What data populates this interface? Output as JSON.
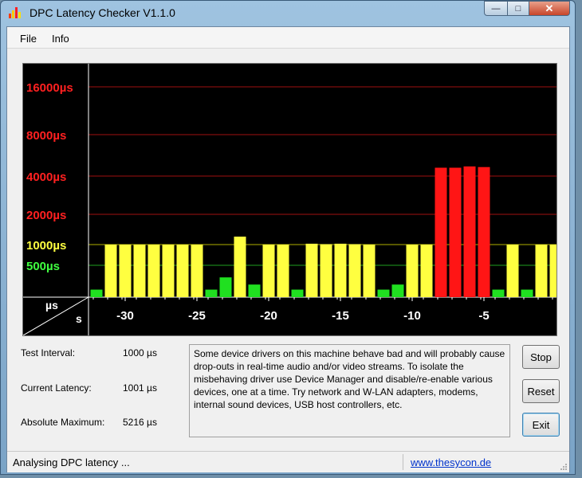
{
  "window": {
    "title": "DPC Latency Checker V1.1.0",
    "close_glyph": "✕",
    "min_glyph": "—",
    "max_glyph": "□"
  },
  "menu": [
    {
      "label": "File"
    },
    {
      "label": "Info"
    }
  ],
  "chart_data": {
    "type": "bar",
    "y_axis_labels": [
      {
        "label": "16000µs",
        "value": 16000,
        "color": "#ff2020"
      },
      {
        "label": "8000µs",
        "value": 8000,
        "color": "#ff2020"
      },
      {
        "label": "4000µs",
        "value": 4000,
        "color": "#ff2020"
      },
      {
        "label": "2000µs",
        "value": 2000,
        "color": "#ff2020"
      },
      {
        "label": "1000µs",
        "value": 1000,
        "color": "#ffff40"
      },
      {
        "label": "500µs",
        "value": 500,
        "color": "#40ff40"
      }
    ],
    "x_ticks": [
      "-30",
      "-25",
      "-20",
      "-15",
      "-10",
      "-5"
    ],
    "corner_y_unit": "µs",
    "corner_x_unit": "s",
    "values": [
      180,
      1000,
      1000,
      1000,
      1000,
      1000,
      1000,
      1000,
      180,
      310,
      1200,
      230,
      1000,
      1000,
      180,
      1020,
      1010,
      1020,
      1010,
      1000,
      180,
      230,
      1000,
      1000,
      4600,
      4600,
      4700,
      4650,
      180,
      1000,
      180,
      1000,
      1000
    ],
    "colors": {
      "green": "#20e020",
      "yellow": "#ffff40",
      "red": "#ff1515"
    }
  },
  "info": {
    "test_interval_label": "Test Interval:",
    "test_interval_value": "1000 µs",
    "current_latency_label": "Current Latency:",
    "current_latency_value": "1001 µs",
    "absolute_max_label": "Absolute Maximum:",
    "absolute_max_value": "5216 µs"
  },
  "message": "Some device drivers on this machine behave bad and will probably cause drop-outs in real-time audio and/or video streams. To isolate the misbehaving driver use Device Manager and disable/re-enable various devices, one at a time. Try network and W-LAN adapters, modems, internal sound devices, USB host controllers, etc.",
  "buttons": {
    "stop": "Stop",
    "reset": "Reset",
    "exit": "Exit"
  },
  "status": {
    "text": "Analysing DPC latency ...",
    "link": "www.thesycon.de"
  }
}
